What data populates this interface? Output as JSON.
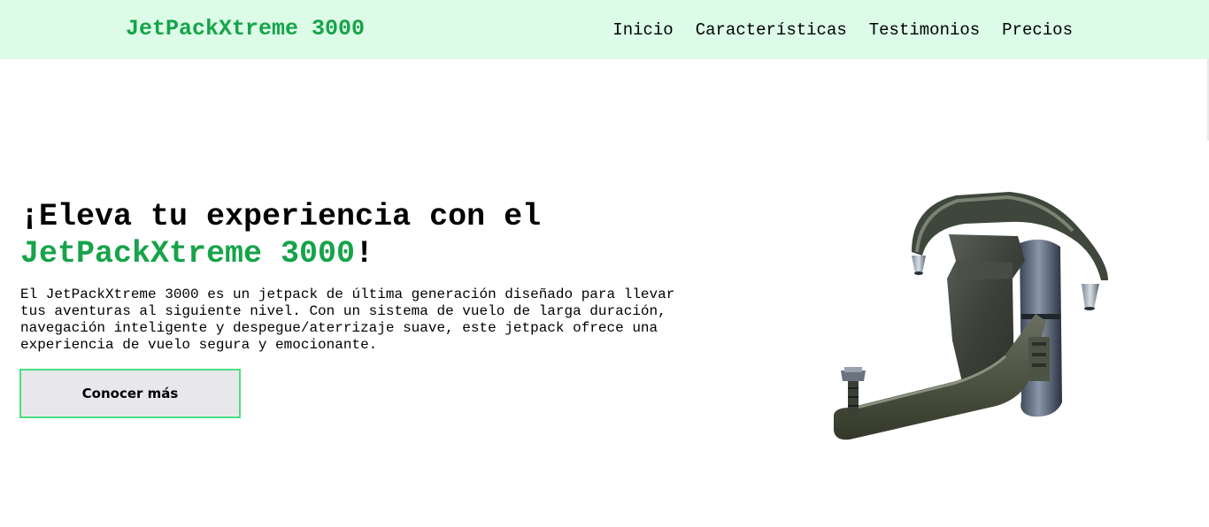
{
  "header": {
    "brand": "JetPackXtreme 3000",
    "nav": [
      "Inicio",
      "Características",
      "Testimonios",
      "Precios"
    ]
  },
  "hero": {
    "title_prefix": "¡Eleva tu experiencia con el ",
    "title_accent": "JetPackXtreme 3000",
    "title_suffix": "!",
    "description": "El JetPackXtreme 3000 es un jetpack de última generación diseñado para llevar tus aventuras al siguiente nivel. Con un sistema de vuelo de larga duración, navegación inteligente y despegue/aterrizaje suave, este jetpack ofrece una experiencia de vuelo segura y emocionante.",
    "cta_label": "Conocer más"
  },
  "colors": {
    "accent": "#16a34a",
    "nav_bg": "#dcfce7",
    "button_border": "#4ade80",
    "button_bg": "#e8e8ec"
  },
  "icons": {
    "hero_image": "jetpack-image"
  }
}
